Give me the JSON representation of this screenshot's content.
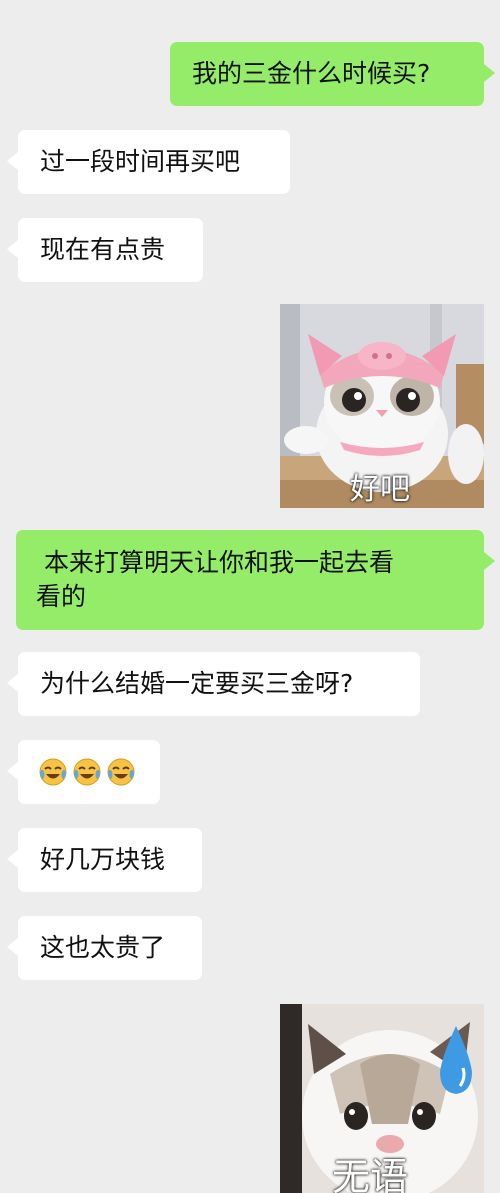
{
  "messages": [
    {
      "side": "right",
      "text": "我的三金什么时候买?"
    },
    {
      "side": "left",
      "text": "过一段时间再买吧"
    },
    {
      "side": "left",
      "text": "现在有点贵"
    },
    {
      "side": "right",
      "sticker": "pink-hat-cat",
      "caption": "好吧"
    },
    {
      "side": "right",
      "line1": " 本来打算明天让你和我一起去看",
      "line2": "看的"
    },
    {
      "side": "left",
      "text": "为什么结婚一定要买三金呀?"
    },
    {
      "side": "left",
      "emoji": [
        "crying-laughing-emoji",
        "crying-laughing-emoji",
        "crying-laughing-emoji"
      ]
    },
    {
      "side": "left",
      "text": "好几万块钱"
    },
    {
      "side": "left",
      "text": "这也太贵了"
    },
    {
      "side": "right",
      "sticker": "speechless-cat",
      "caption": "无语"
    }
  ],
  "colors": {
    "background": "#ededed",
    "bubble_right": "#95ec69",
    "bubble_left": "#ffffff",
    "text": "#111111"
  }
}
